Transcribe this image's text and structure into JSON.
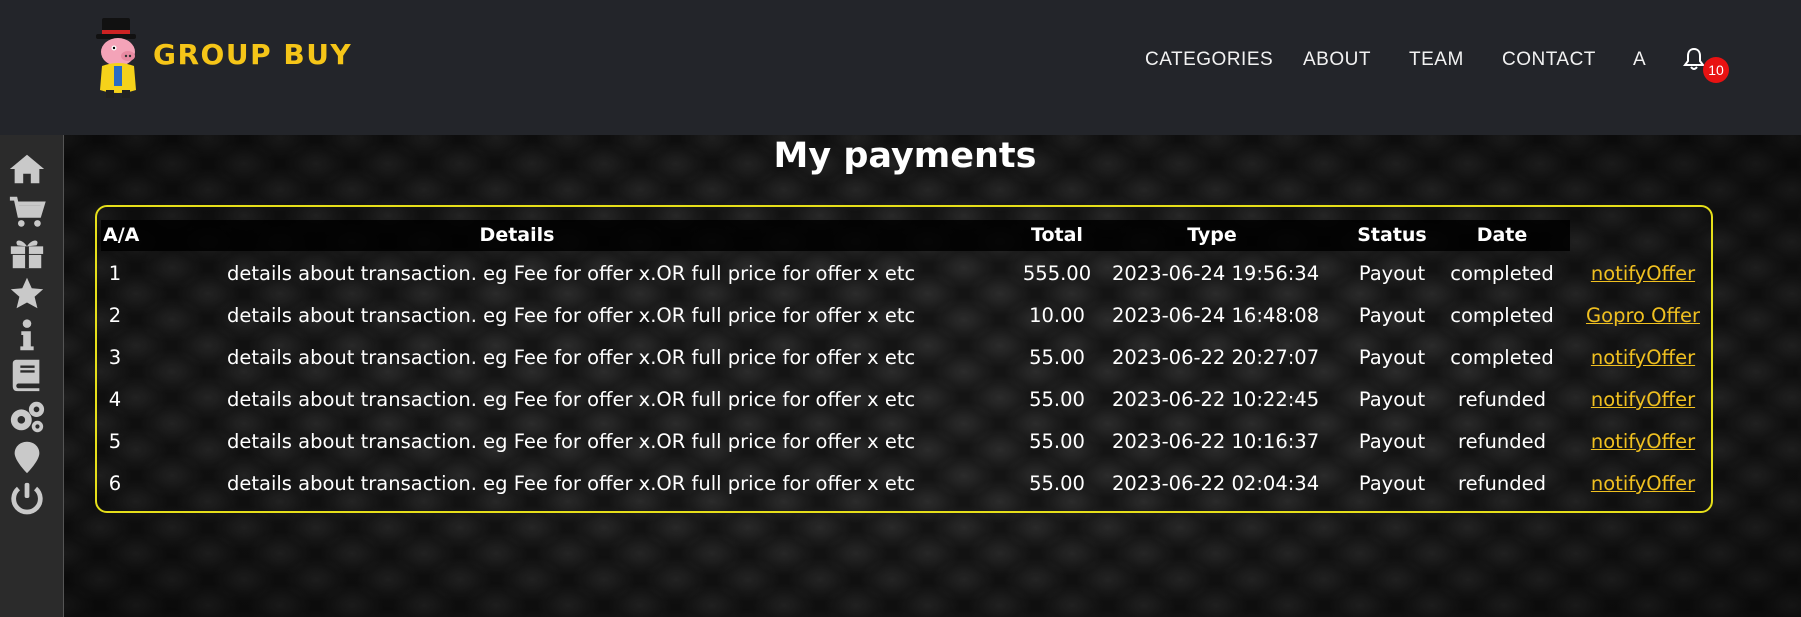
{
  "brand": {
    "name": "GROUP BUY"
  },
  "nav": {
    "items": [
      "CATEGORIES",
      "ABOUT",
      "TEAM",
      "CONTACT",
      "A"
    ],
    "notification_count": "10"
  },
  "sidebar": {
    "icons": [
      "home-icon",
      "cart-icon",
      "gift-icon",
      "star-icon",
      "info-icon",
      "book-icon",
      "gears-icon",
      "location-pin-icon",
      "power-icon"
    ]
  },
  "page": {
    "title": "My payments"
  },
  "table": {
    "headers": [
      "A/A",
      "Details",
      "Total",
      "Type",
      "Status",
      "Date"
    ],
    "rows": [
      {
        "aa": "1",
        "details": "details about transaction. eg Fee for offer x.OR full price for offer x etc",
        "total": "555.00",
        "type": "2023-06-24 19:56:34",
        "status": "Payout",
        "date": "completed",
        "link": "notifyOffer"
      },
      {
        "aa": "2",
        "details": "details about transaction. eg Fee for offer x.OR full price for offer x etc",
        "total": "10.00",
        "type": "2023-06-24 16:48:08",
        "status": "Payout",
        "date": "completed",
        "link": "Gopro Offer"
      },
      {
        "aa": "3",
        "details": "details about transaction. eg Fee for offer x.OR full price for offer x etc",
        "total": "55.00",
        "type": "2023-06-22 20:27:07",
        "status": "Payout",
        "date": "completed",
        "link": "notifyOffer"
      },
      {
        "aa": "4",
        "details": "details about transaction. eg Fee for offer x.OR full price for offer x etc",
        "total": "55.00",
        "type": "2023-06-22 10:22:45",
        "status": "Payout",
        "date": "refunded",
        "link": "notifyOffer"
      },
      {
        "aa": "5",
        "details": "details about transaction. eg Fee for offer x.OR full price for offer x etc",
        "total": "55.00",
        "type": "2023-06-22 10:16:37",
        "status": "Payout",
        "date": "refunded",
        "link": "notifyOffer"
      },
      {
        "aa": "6",
        "details": "details about transaction. eg Fee for offer x.OR full price for offer x etc",
        "total": "55.00",
        "type": "2023-06-22 02:04:34",
        "status": "Payout",
        "date": "refunded",
        "link": "notifyOffer"
      }
    ]
  },
  "colors": {
    "brand": "#f5c518",
    "header_bg": "#23252a",
    "table_border": "#e6df1a",
    "link": "#f0c020",
    "badge": "#e81212"
  }
}
